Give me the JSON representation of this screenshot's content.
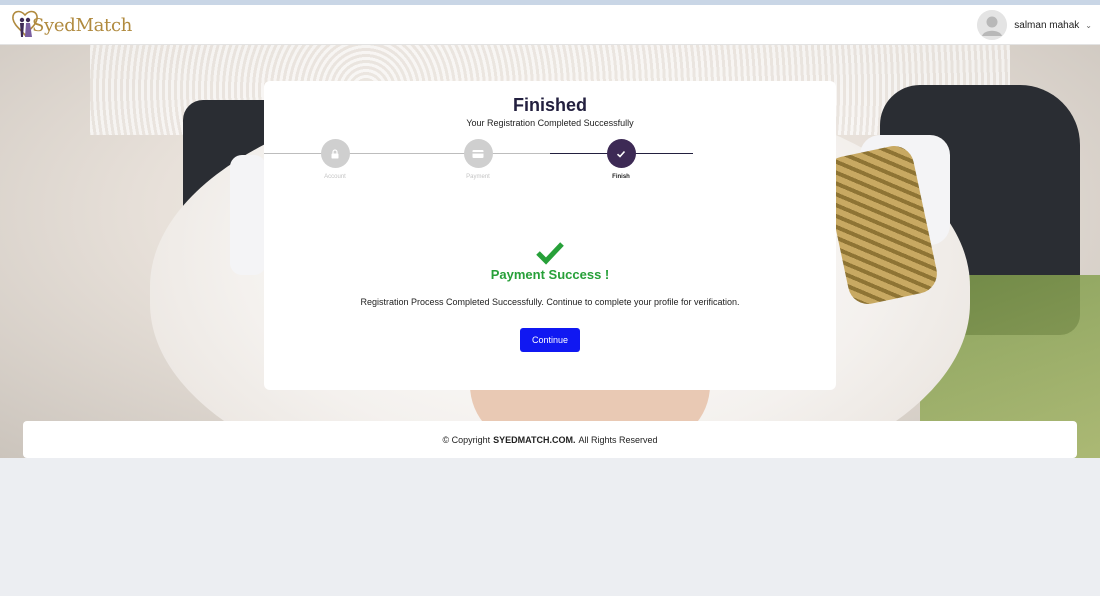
{
  "header": {
    "logo_text": "SyedMatch",
    "user_name": "salman mahak"
  },
  "wizard": {
    "title": "Finished",
    "subtitle": "Your Registration Completed Successfully",
    "steps": [
      {
        "label": "Account",
        "icon": "lock-icon",
        "state": "done"
      },
      {
        "label": "Payment",
        "icon": "credit-card-icon",
        "state": "done"
      },
      {
        "label": "Finish",
        "icon": "check-icon",
        "state": "active"
      }
    ]
  },
  "result": {
    "icon": "check-icon",
    "title": "Payment Success !",
    "message": "Registration Process Completed Successfully. Continue to complete your profile for verification.",
    "button_label": "Continue"
  },
  "footer": {
    "prefix": "© Copyright",
    "site": "SYEDMATCH.COM.",
    "suffix": "All Rights Reserved"
  },
  "colors": {
    "accent_dark": "#23203f",
    "step_active": "#3d2a55",
    "success": "#27a039",
    "button": "#1018f2",
    "logo_gold": "#b08a3e"
  }
}
